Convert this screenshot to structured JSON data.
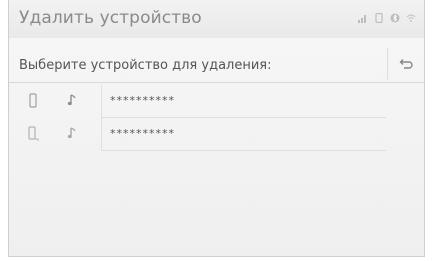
{
  "header": {
    "title": "Удалить устройство",
    "status_icons": [
      "signal-icon",
      "phone-icon",
      "bluetooth-icon",
      "wifi-icon"
    ]
  },
  "subheader": {
    "prompt": "Выберите устройство для удаления:",
    "back_icon": "return-arrow-icon"
  },
  "devices": [
    {
      "name": "**********",
      "icons": [
        "phone-icon",
        "audio-icon"
      ]
    },
    {
      "name": "**********",
      "icons": [
        "phone-connected-icon",
        "audio-icon"
      ]
    }
  ],
  "colors": {
    "background": "#f3f3f3",
    "title": "#8a8a8a",
    "divider": "#dcdcdc"
  }
}
